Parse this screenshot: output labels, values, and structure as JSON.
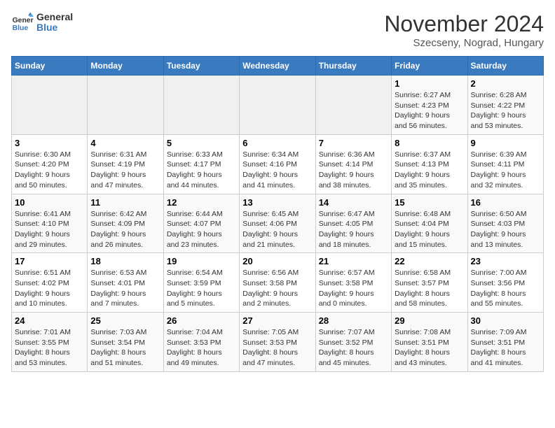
{
  "header": {
    "logo_line1": "General",
    "logo_line2": "Blue",
    "title": "November 2024",
    "subtitle": "Szecseny, Nograd, Hungary"
  },
  "weekdays": [
    "Sunday",
    "Monday",
    "Tuesday",
    "Wednesday",
    "Thursday",
    "Friday",
    "Saturday"
  ],
  "weeks": [
    [
      {
        "day": "",
        "info": ""
      },
      {
        "day": "",
        "info": ""
      },
      {
        "day": "",
        "info": ""
      },
      {
        "day": "",
        "info": ""
      },
      {
        "day": "",
        "info": ""
      },
      {
        "day": "1",
        "info": "Sunrise: 6:27 AM\nSunset: 4:23 PM\nDaylight: 9 hours\nand 56 minutes."
      },
      {
        "day": "2",
        "info": "Sunrise: 6:28 AM\nSunset: 4:22 PM\nDaylight: 9 hours\nand 53 minutes."
      }
    ],
    [
      {
        "day": "3",
        "info": "Sunrise: 6:30 AM\nSunset: 4:20 PM\nDaylight: 9 hours\nand 50 minutes."
      },
      {
        "day": "4",
        "info": "Sunrise: 6:31 AM\nSunset: 4:19 PM\nDaylight: 9 hours\nand 47 minutes."
      },
      {
        "day": "5",
        "info": "Sunrise: 6:33 AM\nSunset: 4:17 PM\nDaylight: 9 hours\nand 44 minutes."
      },
      {
        "day": "6",
        "info": "Sunrise: 6:34 AM\nSunset: 4:16 PM\nDaylight: 9 hours\nand 41 minutes."
      },
      {
        "day": "7",
        "info": "Sunrise: 6:36 AM\nSunset: 4:14 PM\nDaylight: 9 hours\nand 38 minutes."
      },
      {
        "day": "8",
        "info": "Sunrise: 6:37 AM\nSunset: 4:13 PM\nDaylight: 9 hours\nand 35 minutes."
      },
      {
        "day": "9",
        "info": "Sunrise: 6:39 AM\nSunset: 4:11 PM\nDaylight: 9 hours\nand 32 minutes."
      }
    ],
    [
      {
        "day": "10",
        "info": "Sunrise: 6:41 AM\nSunset: 4:10 PM\nDaylight: 9 hours\nand 29 minutes."
      },
      {
        "day": "11",
        "info": "Sunrise: 6:42 AM\nSunset: 4:09 PM\nDaylight: 9 hours\nand 26 minutes."
      },
      {
        "day": "12",
        "info": "Sunrise: 6:44 AM\nSunset: 4:07 PM\nDaylight: 9 hours\nand 23 minutes."
      },
      {
        "day": "13",
        "info": "Sunrise: 6:45 AM\nSunset: 4:06 PM\nDaylight: 9 hours\nand 21 minutes."
      },
      {
        "day": "14",
        "info": "Sunrise: 6:47 AM\nSunset: 4:05 PM\nDaylight: 9 hours\nand 18 minutes."
      },
      {
        "day": "15",
        "info": "Sunrise: 6:48 AM\nSunset: 4:04 PM\nDaylight: 9 hours\nand 15 minutes."
      },
      {
        "day": "16",
        "info": "Sunrise: 6:50 AM\nSunset: 4:03 PM\nDaylight: 9 hours\nand 13 minutes."
      }
    ],
    [
      {
        "day": "17",
        "info": "Sunrise: 6:51 AM\nSunset: 4:02 PM\nDaylight: 9 hours\nand 10 minutes."
      },
      {
        "day": "18",
        "info": "Sunrise: 6:53 AM\nSunset: 4:01 PM\nDaylight: 9 hours\nand 7 minutes."
      },
      {
        "day": "19",
        "info": "Sunrise: 6:54 AM\nSunset: 3:59 PM\nDaylight: 9 hours\nand 5 minutes."
      },
      {
        "day": "20",
        "info": "Sunrise: 6:56 AM\nSunset: 3:58 PM\nDaylight: 9 hours\nand 2 minutes."
      },
      {
        "day": "21",
        "info": "Sunrise: 6:57 AM\nSunset: 3:58 PM\nDaylight: 9 hours\nand 0 minutes."
      },
      {
        "day": "22",
        "info": "Sunrise: 6:58 AM\nSunset: 3:57 PM\nDaylight: 8 hours\nand 58 minutes."
      },
      {
        "day": "23",
        "info": "Sunrise: 7:00 AM\nSunset: 3:56 PM\nDaylight: 8 hours\nand 55 minutes."
      }
    ],
    [
      {
        "day": "24",
        "info": "Sunrise: 7:01 AM\nSunset: 3:55 PM\nDaylight: 8 hours\nand 53 minutes."
      },
      {
        "day": "25",
        "info": "Sunrise: 7:03 AM\nSunset: 3:54 PM\nDaylight: 8 hours\nand 51 minutes."
      },
      {
        "day": "26",
        "info": "Sunrise: 7:04 AM\nSunset: 3:53 PM\nDaylight: 8 hours\nand 49 minutes."
      },
      {
        "day": "27",
        "info": "Sunrise: 7:05 AM\nSunset: 3:53 PM\nDaylight: 8 hours\nand 47 minutes."
      },
      {
        "day": "28",
        "info": "Sunrise: 7:07 AM\nSunset: 3:52 PM\nDaylight: 8 hours\nand 45 minutes."
      },
      {
        "day": "29",
        "info": "Sunrise: 7:08 AM\nSunset: 3:51 PM\nDaylight: 8 hours\nand 43 minutes."
      },
      {
        "day": "30",
        "info": "Sunrise: 7:09 AM\nSunset: 3:51 PM\nDaylight: 8 hours\nand 41 minutes."
      }
    ]
  ]
}
